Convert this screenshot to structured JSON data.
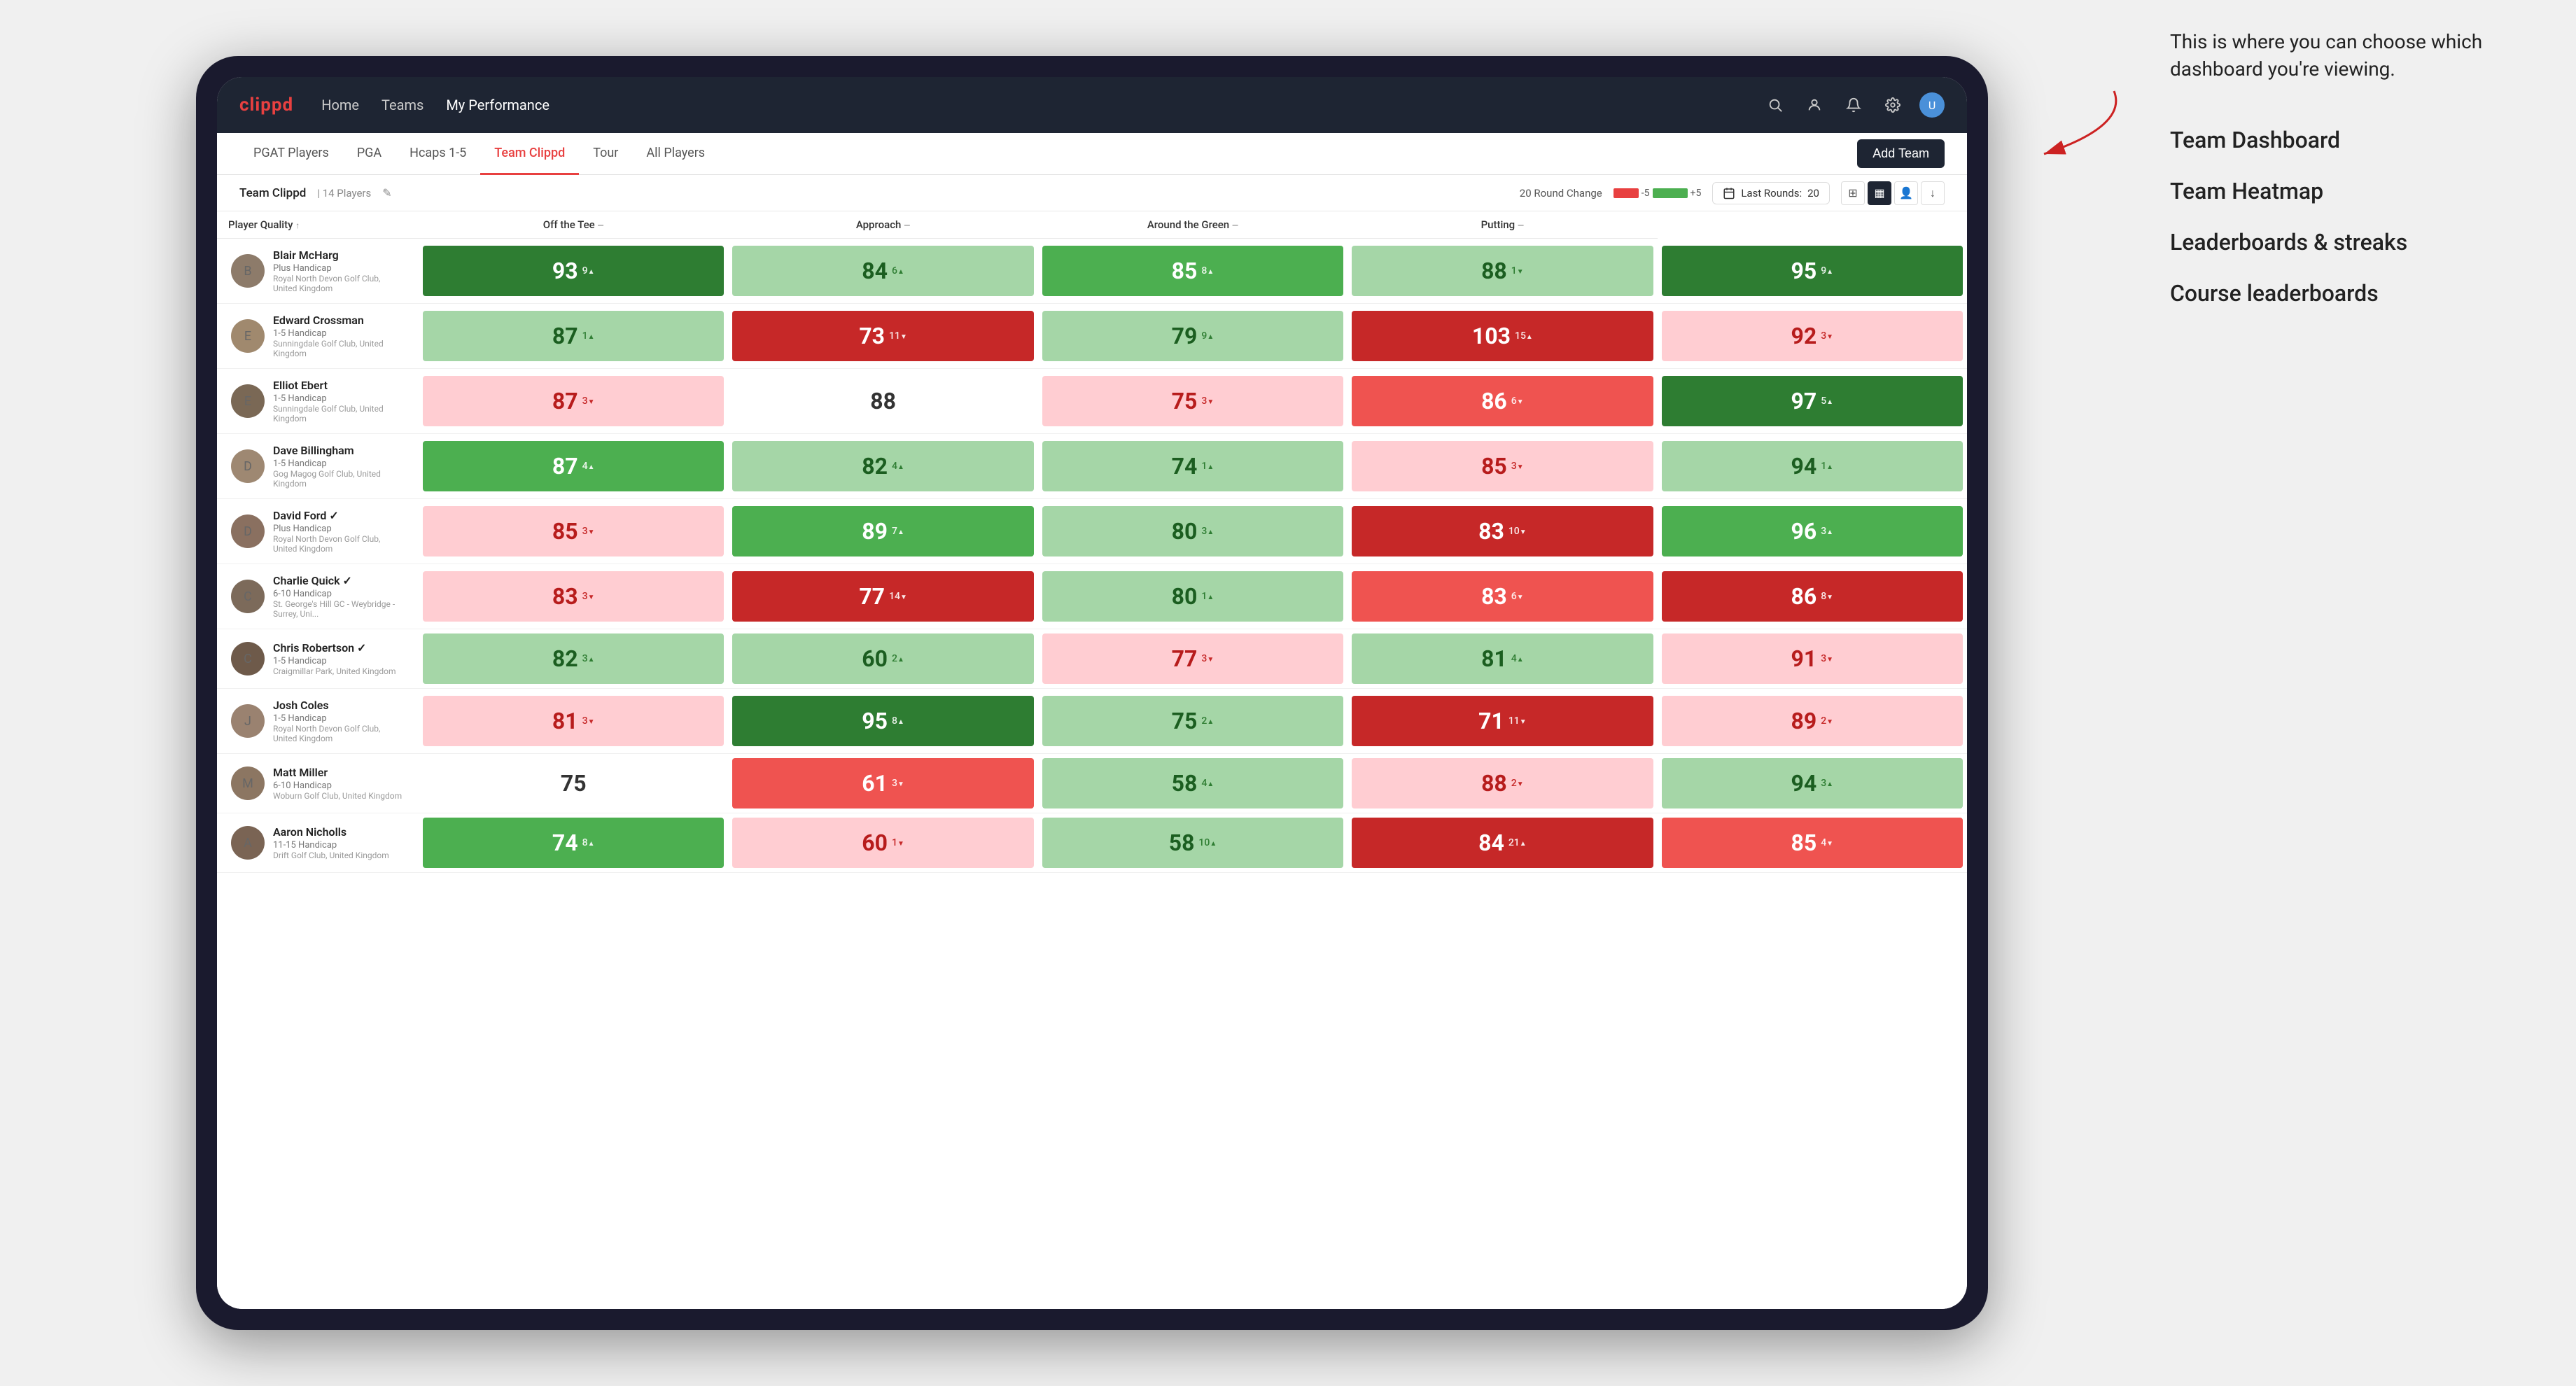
{
  "annotation": {
    "intro_text": "This is where you can choose which dashboard you're viewing.",
    "items": [
      "Team Dashboard",
      "Team Heatmap",
      "Leaderboards & streaks",
      "Course leaderboards"
    ]
  },
  "navbar": {
    "logo": "clippd",
    "links": [
      "Home",
      "Teams",
      "My Performance"
    ],
    "active_link": "My Performance"
  },
  "sub_nav": {
    "tabs": [
      "PGAT Players",
      "PGA",
      "Hcaps 1-5",
      "Team Clippd",
      "Tour",
      "All Players"
    ],
    "active_tab": "Team Clippd",
    "add_team_label": "Add Team"
  },
  "team_header": {
    "team_name": "Team Clippd",
    "separator": "|",
    "player_count": "14 Players",
    "round_change_label": "20 Round Change",
    "bar_neg": "-5",
    "bar_pos": "+5",
    "last_rounds_label": "Last Rounds:",
    "last_rounds_value": "20"
  },
  "table": {
    "columns": [
      {
        "key": "player",
        "label": "Player Quality"
      },
      {
        "key": "tee",
        "label": "Off the Tee"
      },
      {
        "key": "approach",
        "label": "Approach"
      },
      {
        "key": "green",
        "label": "Around the Green"
      },
      {
        "key": "putting",
        "label": "Putting"
      }
    ],
    "players": [
      {
        "name": "Blair McHarg",
        "handicap": "Plus Handicap",
        "club": "Royal North Devon Golf Club, United Kingdom",
        "avatar_color": "#8d7b6a",
        "scores": [
          {
            "value": "93",
            "change": "9",
            "dir": "up",
            "color": "green-dark"
          },
          {
            "value": "84",
            "change": "6",
            "dir": "up",
            "color": "green-light"
          },
          {
            "value": "85",
            "change": "8",
            "dir": "up",
            "color": "green-med"
          },
          {
            "value": "88",
            "change": "1",
            "dir": "down",
            "color": "green-light"
          },
          {
            "value": "95",
            "change": "9",
            "dir": "up",
            "color": "green-dark"
          }
        ]
      },
      {
        "name": "Edward Crossman",
        "handicap": "1-5 Handicap",
        "club": "Sunningdale Golf Club, United Kingdom",
        "avatar_color": "#a0896e",
        "scores": [
          {
            "value": "87",
            "change": "1",
            "dir": "up",
            "color": "green-light"
          },
          {
            "value": "73",
            "change": "11",
            "dir": "down",
            "color": "red-dark"
          },
          {
            "value": "79",
            "change": "9",
            "dir": "up",
            "color": "green-light"
          },
          {
            "value": "103",
            "change": "15",
            "dir": "up",
            "color": "red-dark"
          },
          {
            "value": "92",
            "change": "3",
            "dir": "down",
            "color": "red-light"
          }
        ]
      },
      {
        "name": "Elliot Ebert",
        "handicap": "1-5 Handicap",
        "club": "Sunningdale Golf Club, United Kingdom",
        "avatar_color": "#7a6855",
        "scores": [
          {
            "value": "87",
            "change": "3",
            "dir": "down",
            "color": "red-light"
          },
          {
            "value": "88",
            "change": "",
            "dir": "",
            "color": "white"
          },
          {
            "value": "75",
            "change": "3",
            "dir": "down",
            "color": "red-light"
          },
          {
            "value": "86",
            "change": "6",
            "dir": "down",
            "color": "red-med"
          },
          {
            "value": "97",
            "change": "5",
            "dir": "up",
            "color": "green-dark"
          }
        ]
      },
      {
        "name": "Dave Billingham",
        "handicap": "1-5 Handicap",
        "club": "Gog Magog Golf Club, United Kingdom",
        "avatar_color": "#9e8872",
        "scores": [
          {
            "value": "87",
            "change": "4",
            "dir": "up",
            "color": "green-med"
          },
          {
            "value": "82",
            "change": "4",
            "dir": "up",
            "color": "green-light"
          },
          {
            "value": "74",
            "change": "1",
            "dir": "up",
            "color": "green-light"
          },
          {
            "value": "85",
            "change": "3",
            "dir": "down",
            "color": "red-light"
          },
          {
            "value": "94",
            "change": "1",
            "dir": "up",
            "color": "green-light"
          }
        ]
      },
      {
        "name": "David Ford",
        "handicap": "Plus Handicap",
        "club": "Royal North Devon Golf Club, United Kingdom",
        "avatar_color": "#8a7060",
        "verified": true,
        "scores": [
          {
            "value": "85",
            "change": "3",
            "dir": "down",
            "color": "red-light"
          },
          {
            "value": "89",
            "change": "7",
            "dir": "up",
            "color": "green-med"
          },
          {
            "value": "80",
            "change": "3",
            "dir": "up",
            "color": "green-light"
          },
          {
            "value": "83",
            "change": "10",
            "dir": "down",
            "color": "red-dark"
          },
          {
            "value": "96",
            "change": "3",
            "dir": "up",
            "color": "green-med"
          }
        ]
      },
      {
        "name": "Charlie Quick",
        "handicap": "6-10 Handicap",
        "club": "St. George's Hill GC - Weybridge - Surrey, Uni...",
        "avatar_color": "#7c6a5a",
        "verified": true,
        "scores": [
          {
            "value": "83",
            "change": "3",
            "dir": "down",
            "color": "red-light"
          },
          {
            "value": "77",
            "change": "14",
            "dir": "down",
            "color": "red-dark"
          },
          {
            "value": "80",
            "change": "1",
            "dir": "up",
            "color": "green-light"
          },
          {
            "value": "83",
            "change": "6",
            "dir": "down",
            "color": "red-med"
          },
          {
            "value": "86",
            "change": "8",
            "dir": "down",
            "color": "red-dark"
          }
        ]
      },
      {
        "name": "Chris Robertson",
        "handicap": "1-5 Handicap",
        "club": "Craigmillar Park, United Kingdom",
        "avatar_color": "#6e5a4a",
        "verified": true,
        "scores": [
          {
            "value": "82",
            "change": "3",
            "dir": "up",
            "color": "green-light"
          },
          {
            "value": "60",
            "change": "2",
            "dir": "up",
            "color": "green-light"
          },
          {
            "value": "77",
            "change": "3",
            "dir": "down",
            "color": "red-light"
          },
          {
            "value": "81",
            "change": "4",
            "dir": "up",
            "color": "green-light"
          },
          {
            "value": "91",
            "change": "3",
            "dir": "down",
            "color": "red-light"
          }
        ]
      },
      {
        "name": "Josh Coles",
        "handicap": "1-5 Handicap",
        "club": "Royal North Devon Golf Club, United Kingdom",
        "avatar_color": "#9a8270",
        "scores": [
          {
            "value": "81",
            "change": "3",
            "dir": "down",
            "color": "red-light"
          },
          {
            "value": "95",
            "change": "8",
            "dir": "up",
            "color": "green-dark"
          },
          {
            "value": "75",
            "change": "2",
            "dir": "up",
            "color": "green-light"
          },
          {
            "value": "71",
            "change": "11",
            "dir": "down",
            "color": "red-dark"
          },
          {
            "value": "89",
            "change": "2",
            "dir": "down",
            "color": "red-light"
          }
        ]
      },
      {
        "name": "Matt Miller",
        "handicap": "6-10 Handicap",
        "club": "Woburn Golf Club, United Kingdom",
        "avatar_color": "#8c7662",
        "scores": [
          {
            "value": "75",
            "change": "",
            "dir": "",
            "color": "white"
          },
          {
            "value": "61",
            "change": "3",
            "dir": "down",
            "color": "red-med"
          },
          {
            "value": "58",
            "change": "4",
            "dir": "up",
            "color": "green-light"
          },
          {
            "value": "88",
            "change": "2",
            "dir": "down",
            "color": "red-light"
          },
          {
            "value": "94",
            "change": "3",
            "dir": "up",
            "color": "green-light"
          }
        ]
      },
      {
        "name": "Aaron Nicholls",
        "handicap": "11-15 Handicap",
        "club": "Drift Golf Club, United Kingdom",
        "avatar_color": "#7a6454",
        "scores": [
          {
            "value": "74",
            "change": "8",
            "dir": "up",
            "color": "green-med"
          },
          {
            "value": "60",
            "change": "1",
            "dir": "down",
            "color": "red-light"
          },
          {
            "value": "58",
            "change": "10",
            "dir": "up",
            "color": "green-light"
          },
          {
            "value": "84",
            "change": "21",
            "dir": "up",
            "color": "red-dark"
          },
          {
            "value": "85",
            "change": "4",
            "dir": "down",
            "color": "red-med"
          }
        ]
      }
    ]
  }
}
